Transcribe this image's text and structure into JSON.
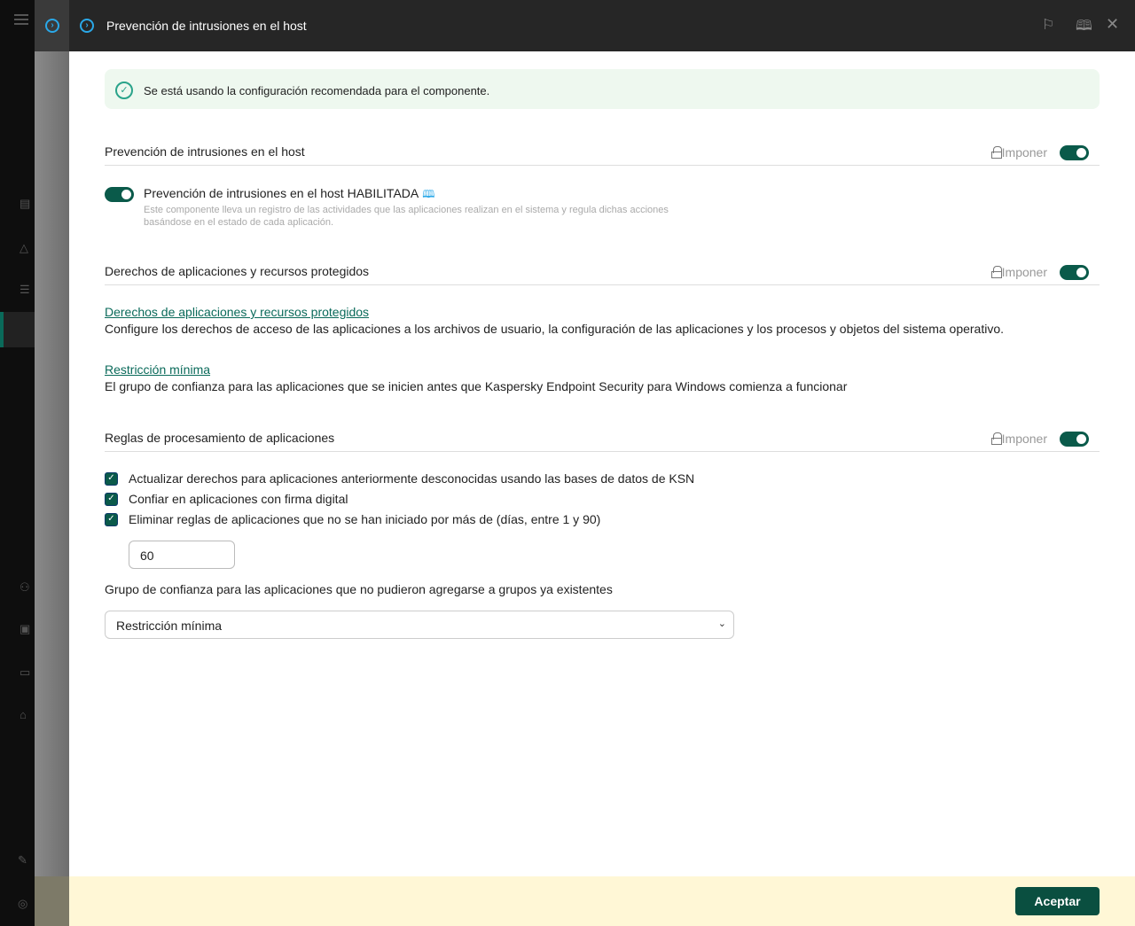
{
  "header": {
    "title": "Prevención de intrusiones en el host"
  },
  "banner": {
    "text": "Se está usando la configuración recomendada para el componente."
  },
  "enforce_label": "Imponer",
  "section1": {
    "title": "Prevención de intrusiones en el host",
    "toggle_label": "Prevención de intrusiones en el host HABILITADA",
    "desc_line1": "Este componente lleva un registro de las actividades que las aplicaciones realizan en el sistema y regula dichas acciones",
    "desc_line2": "basándose en el estado de cada aplicación."
  },
  "section2": {
    "title": "Derechos de aplicaciones y recursos protegidos",
    "links": [
      {
        "label": "Derechos de aplicaciones y recursos protegidos",
        "desc": "Configure los derechos de acceso de las aplicaciones a los archivos de usuario, la configuración de las aplicaciones y los procesos y objetos del sistema operativo."
      },
      {
        "label": "Restricción mínima",
        "desc": "El grupo de confianza para las aplicaciones que se inicien antes que Kaspersky Endpoint Security para Windows comienza a funcionar"
      }
    ]
  },
  "section3": {
    "title": "Reglas de procesamiento de aplicaciones",
    "checkboxes": [
      "Actualizar derechos para aplicaciones anteriormente desconocidas usando las bases de datos de KSN",
      "Confiar en aplicaciones con firma digital",
      "Eliminar reglas de aplicaciones que no se han iniciado por más de (días, entre 1 y 90)"
    ],
    "days_value": "60",
    "group_label": "Grupo de confianza para las aplicaciones que no pudieron agregarse a grupos ya existentes",
    "group_selected": "Restricción mínima"
  },
  "footer": {
    "accept": "Aceptar"
  }
}
